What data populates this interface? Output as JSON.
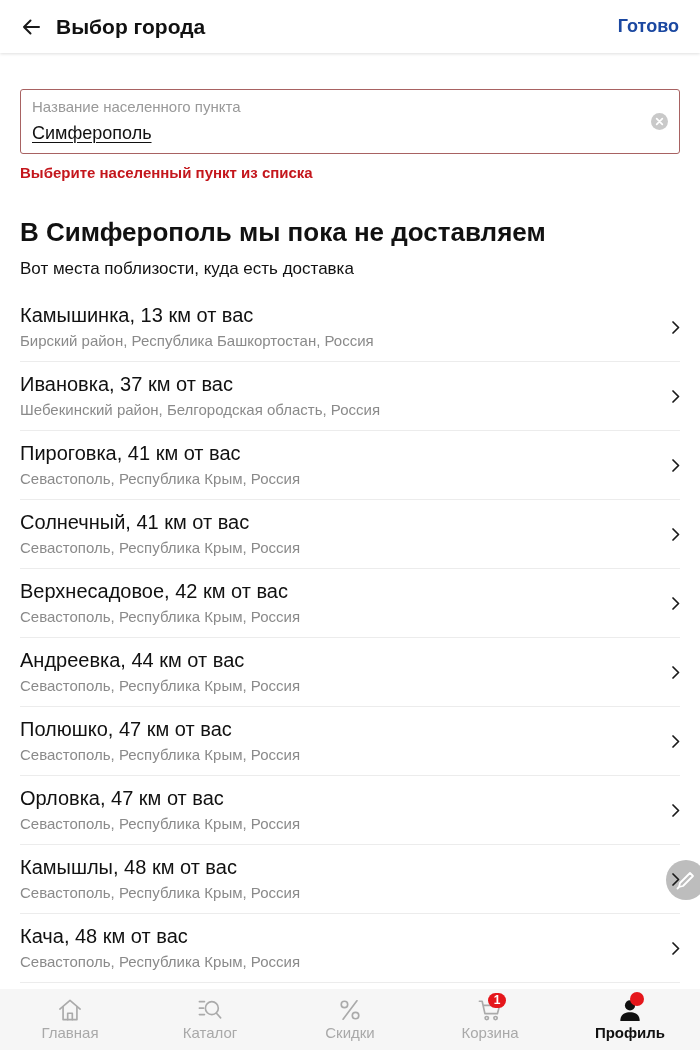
{
  "header": {
    "title": "Выбор города",
    "done_button": "Готово"
  },
  "city_field": {
    "label": "Название населенного пункта",
    "value": "Симферополь",
    "invalid": true,
    "error": "Выберите населенный пункт из списка"
  },
  "notice": {
    "title": "В Симферополь мы пока не доставляем",
    "subtitle": "Вот места поблизости, куда есть доставка"
  },
  "places": [
    {
      "name": "Камышинка, 13 км от вас",
      "region": "Бирский район, Республика Башкортостан, Россия"
    },
    {
      "name": "Ивановка, 37 км от вас",
      "region": "Шебекинский район, Белгородская область, Россия"
    },
    {
      "name": "Пироговка, 41 км от вас",
      "region": "Севастополь, Республика Крым, Россия"
    },
    {
      "name": "Солнечный, 41 км от вас",
      "region": "Севастополь, Республика Крым, Россия"
    },
    {
      "name": "Верхнесадовое, 42 км от вас",
      "region": "Севастополь, Республика Крым, Россия"
    },
    {
      "name": "Андреевка, 44 км от вас",
      "region": "Севастополь, Республика Крым, Россия"
    },
    {
      "name": "Полюшко, 47 км от вас",
      "region": "Севастополь, Республика Крым, Россия"
    },
    {
      "name": "Орловка, 47 км от вас",
      "region": "Севастополь, Республика Крым, Россия"
    },
    {
      "name": "Камышлы, 48 км от вас",
      "region": "Севастополь, Республика Крым, Россия"
    },
    {
      "name": "Кача, 48 км от вас",
      "region": "Севастополь, Республика Крым, Россия"
    }
  ],
  "bottom_nav": [
    {
      "label": "Главная",
      "kind": "home",
      "selected": false,
      "notification": false
    },
    {
      "label": "Каталог",
      "kind": "catalog",
      "selected": false,
      "notification": false
    },
    {
      "label": "Скидки",
      "kind": "discounts",
      "selected": false,
      "notification": false
    },
    {
      "label": "Корзина",
      "kind": "cart",
      "selected": false,
      "notification": false,
      "badge": "1"
    },
    {
      "label": "Профиль",
      "kind": "profile",
      "selected": true,
      "notification": true
    }
  ]
}
